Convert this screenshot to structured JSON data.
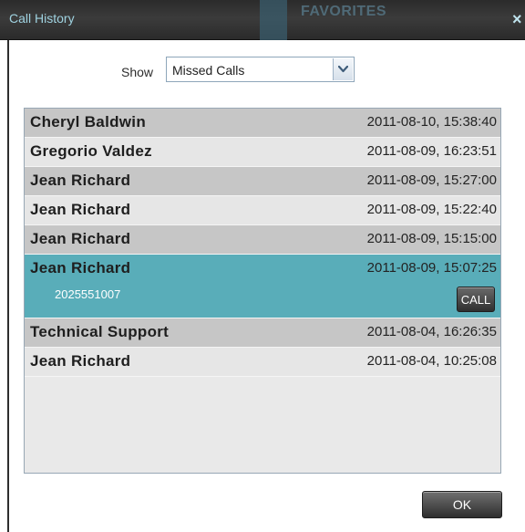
{
  "window": {
    "title": "Call History",
    "background_tab_label": "FAVORITES",
    "close_glyph": "×"
  },
  "filter": {
    "label": "Show",
    "selected": "Missed Calls"
  },
  "calls": [
    {
      "name": "Cheryl Baldwin",
      "time": "2011-08-10, 15:38:40"
    },
    {
      "name": "Gregorio Valdez",
      "time": "2011-08-09, 16:23:51"
    },
    {
      "name": "Jean Richard",
      "time": "2011-08-09, 15:27:00"
    },
    {
      "name": "Jean Richard",
      "time": "2011-08-09, 15:22:40"
    },
    {
      "name": "Jean Richard",
      "time": "2011-08-09, 15:15:00"
    },
    {
      "name": "Jean Richard",
      "time": "2011-08-09, 15:07:25",
      "number": "2025551007",
      "action": "CALL"
    },
    {
      "name": "Technical Support",
      "time": "2011-08-04, 16:26:35"
    },
    {
      "name": "Jean Richard",
      "time": "2011-08-04, 10:25:08"
    }
  ],
  "footer": {
    "ok_label": "OK"
  },
  "colors": {
    "selected_row": "#59adb9",
    "dark_row": "#c6c6c6",
    "light_row": "#e6e6e6",
    "title_text": "#9fd2e0"
  }
}
